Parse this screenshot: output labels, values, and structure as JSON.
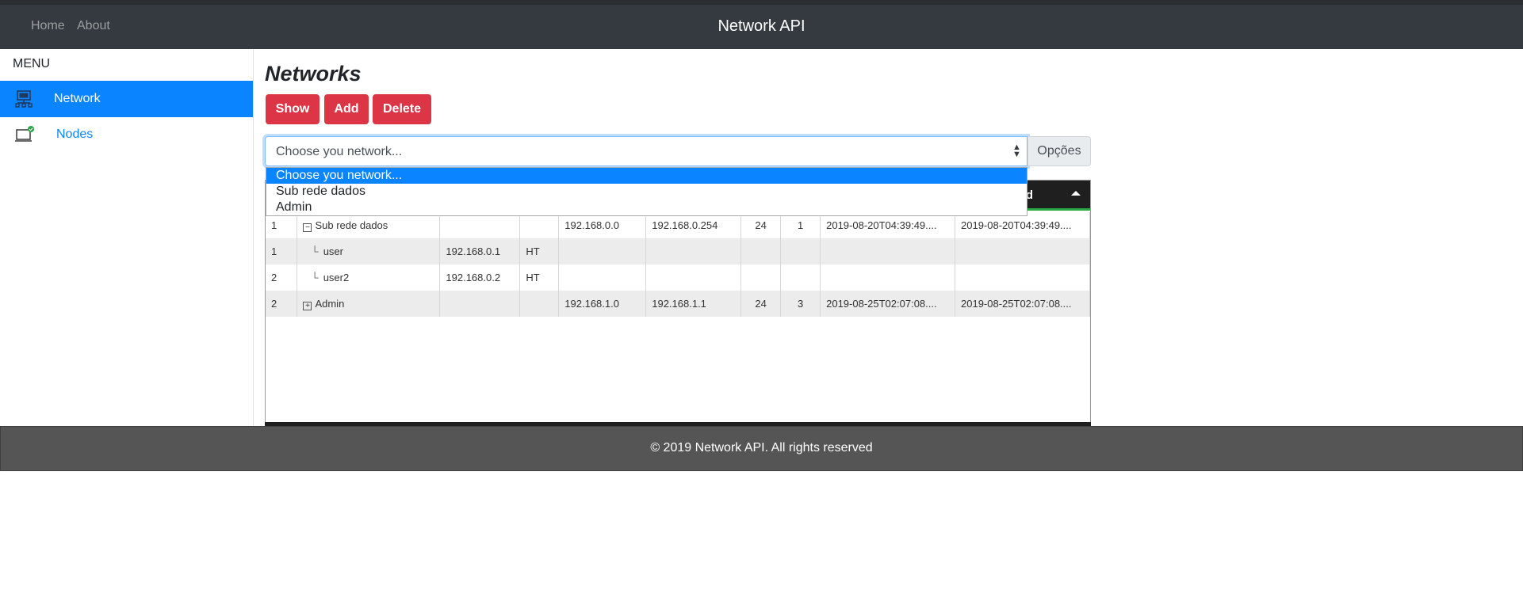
{
  "navbar": {
    "links": [
      "Home",
      "About"
    ],
    "brand": "Network API"
  },
  "sidebar": {
    "title": "MENU",
    "items": [
      {
        "label": "Network",
        "icon": "monitor-network-icon",
        "active": true
      },
      {
        "label": "Nodes",
        "icon": "laptop-check-icon",
        "active": false
      }
    ]
  },
  "main": {
    "title": "Networks",
    "buttons": {
      "show": "Show",
      "add": "Add",
      "delete": "Delete"
    },
    "select": {
      "value": "Choose you network...",
      "options": [
        "Choose you network...",
        "Sub rede dados",
        "Admin"
      ]
    },
    "options_button": "Opções",
    "table": {
      "visible_header_fragment": "d",
      "rows": [
        {
          "id": "1",
          "name": "Sub rede dados",
          "tree": "collapse-icon",
          "ip": "",
          "type": "",
          "network": "192.168.0.0",
          "gateway": "192.168.0.254",
          "mask": "24",
          "count": "1",
          "created": "2019-08-20T04:39:49....",
          "updated": "2019-08-20T04:39:49...."
        },
        {
          "id": "1",
          "name": "user",
          "tree": "child",
          "ip": "192.168.0.1",
          "type": "HT",
          "network": "",
          "gateway": "",
          "mask": "",
          "count": "",
          "created": "",
          "updated": ""
        },
        {
          "id": "2",
          "name": "user2",
          "tree": "child",
          "ip": "192.168.0.2",
          "type": "HT",
          "network": "",
          "gateway": "",
          "mask": "",
          "count": "",
          "created": "",
          "updated": ""
        },
        {
          "id": "2",
          "name": "Admin",
          "tree": "expand-icon",
          "ip": "",
          "type": "",
          "network": "192.168.1.0",
          "gateway": "192.168.1.1",
          "mask": "24",
          "count": "3",
          "created": "2019-08-25T02:07:08....",
          "updated": "2019-08-25T02:07:08...."
        }
      ]
    }
  },
  "footer": {
    "text": "© 2019 Network API. All rights reserved"
  },
  "colors": {
    "navbar": "#343a40",
    "primary": "#0b84ff",
    "danger": "#dc3545",
    "footer": "#555555",
    "table_header": "#1f1f1f",
    "header_accent": "#28a745"
  }
}
